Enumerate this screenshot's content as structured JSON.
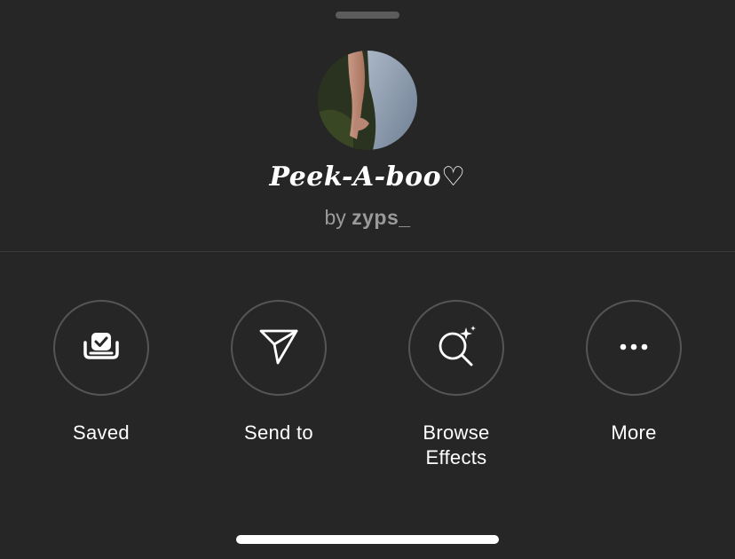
{
  "effect": {
    "name": "Peek-A-boo♡",
    "by_prefix": "by",
    "creator": "zyps_"
  },
  "actions": [
    {
      "label": "Saved",
      "icon": "saved-icon"
    },
    {
      "label": "Send to",
      "icon": "send-icon"
    },
    {
      "label": "Browse\nEffects",
      "icon": "browse-effects-icon"
    },
    {
      "label": "More",
      "icon": "more-icon"
    }
  ],
  "colors": {
    "background": "#262626",
    "circle_border": "#555555",
    "secondary_text": "#9a9a9a",
    "primary_text": "#ffffff"
  }
}
